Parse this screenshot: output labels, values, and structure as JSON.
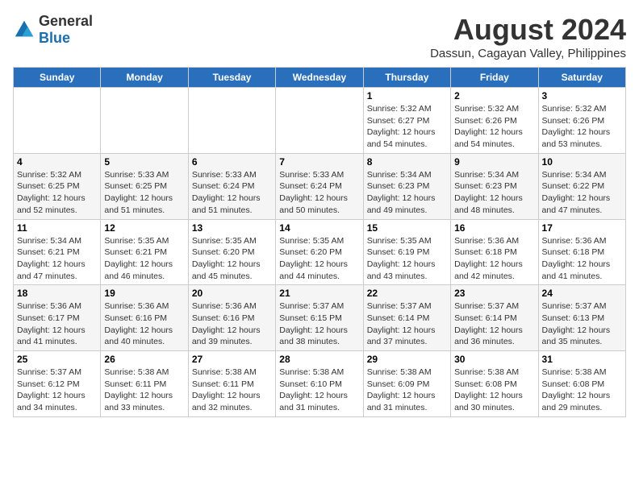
{
  "logo": {
    "general": "General",
    "blue": "Blue"
  },
  "title": "August 2024",
  "subtitle": "Dassun, Cagayan Valley, Philippines",
  "weekdays": [
    "Sunday",
    "Monday",
    "Tuesday",
    "Wednesday",
    "Thursday",
    "Friday",
    "Saturday"
  ],
  "weeks": [
    [
      {
        "day": "",
        "info": ""
      },
      {
        "day": "",
        "info": ""
      },
      {
        "day": "",
        "info": ""
      },
      {
        "day": "",
        "info": ""
      },
      {
        "day": "1",
        "info": "Sunrise: 5:32 AM\nSunset: 6:27 PM\nDaylight: 12 hours\nand 54 minutes."
      },
      {
        "day": "2",
        "info": "Sunrise: 5:32 AM\nSunset: 6:26 PM\nDaylight: 12 hours\nand 54 minutes."
      },
      {
        "day": "3",
        "info": "Sunrise: 5:32 AM\nSunset: 6:26 PM\nDaylight: 12 hours\nand 53 minutes."
      }
    ],
    [
      {
        "day": "4",
        "info": "Sunrise: 5:32 AM\nSunset: 6:25 PM\nDaylight: 12 hours\nand 52 minutes."
      },
      {
        "day": "5",
        "info": "Sunrise: 5:33 AM\nSunset: 6:25 PM\nDaylight: 12 hours\nand 51 minutes."
      },
      {
        "day": "6",
        "info": "Sunrise: 5:33 AM\nSunset: 6:24 PM\nDaylight: 12 hours\nand 51 minutes."
      },
      {
        "day": "7",
        "info": "Sunrise: 5:33 AM\nSunset: 6:24 PM\nDaylight: 12 hours\nand 50 minutes."
      },
      {
        "day": "8",
        "info": "Sunrise: 5:34 AM\nSunset: 6:23 PM\nDaylight: 12 hours\nand 49 minutes."
      },
      {
        "day": "9",
        "info": "Sunrise: 5:34 AM\nSunset: 6:23 PM\nDaylight: 12 hours\nand 48 minutes."
      },
      {
        "day": "10",
        "info": "Sunrise: 5:34 AM\nSunset: 6:22 PM\nDaylight: 12 hours\nand 47 minutes."
      }
    ],
    [
      {
        "day": "11",
        "info": "Sunrise: 5:34 AM\nSunset: 6:21 PM\nDaylight: 12 hours\nand 47 minutes."
      },
      {
        "day": "12",
        "info": "Sunrise: 5:35 AM\nSunset: 6:21 PM\nDaylight: 12 hours\nand 46 minutes."
      },
      {
        "day": "13",
        "info": "Sunrise: 5:35 AM\nSunset: 6:20 PM\nDaylight: 12 hours\nand 45 minutes."
      },
      {
        "day": "14",
        "info": "Sunrise: 5:35 AM\nSunset: 6:20 PM\nDaylight: 12 hours\nand 44 minutes."
      },
      {
        "day": "15",
        "info": "Sunrise: 5:35 AM\nSunset: 6:19 PM\nDaylight: 12 hours\nand 43 minutes."
      },
      {
        "day": "16",
        "info": "Sunrise: 5:36 AM\nSunset: 6:18 PM\nDaylight: 12 hours\nand 42 minutes."
      },
      {
        "day": "17",
        "info": "Sunrise: 5:36 AM\nSunset: 6:18 PM\nDaylight: 12 hours\nand 41 minutes."
      }
    ],
    [
      {
        "day": "18",
        "info": "Sunrise: 5:36 AM\nSunset: 6:17 PM\nDaylight: 12 hours\nand 41 minutes."
      },
      {
        "day": "19",
        "info": "Sunrise: 5:36 AM\nSunset: 6:16 PM\nDaylight: 12 hours\nand 40 minutes."
      },
      {
        "day": "20",
        "info": "Sunrise: 5:36 AM\nSunset: 6:16 PM\nDaylight: 12 hours\nand 39 minutes."
      },
      {
        "day": "21",
        "info": "Sunrise: 5:37 AM\nSunset: 6:15 PM\nDaylight: 12 hours\nand 38 minutes."
      },
      {
        "day": "22",
        "info": "Sunrise: 5:37 AM\nSunset: 6:14 PM\nDaylight: 12 hours\nand 37 minutes."
      },
      {
        "day": "23",
        "info": "Sunrise: 5:37 AM\nSunset: 6:14 PM\nDaylight: 12 hours\nand 36 minutes."
      },
      {
        "day": "24",
        "info": "Sunrise: 5:37 AM\nSunset: 6:13 PM\nDaylight: 12 hours\nand 35 minutes."
      }
    ],
    [
      {
        "day": "25",
        "info": "Sunrise: 5:37 AM\nSunset: 6:12 PM\nDaylight: 12 hours\nand 34 minutes."
      },
      {
        "day": "26",
        "info": "Sunrise: 5:38 AM\nSunset: 6:11 PM\nDaylight: 12 hours\nand 33 minutes."
      },
      {
        "day": "27",
        "info": "Sunrise: 5:38 AM\nSunset: 6:11 PM\nDaylight: 12 hours\nand 32 minutes."
      },
      {
        "day": "28",
        "info": "Sunrise: 5:38 AM\nSunset: 6:10 PM\nDaylight: 12 hours\nand 31 minutes."
      },
      {
        "day": "29",
        "info": "Sunrise: 5:38 AM\nSunset: 6:09 PM\nDaylight: 12 hours\nand 31 minutes."
      },
      {
        "day": "30",
        "info": "Sunrise: 5:38 AM\nSunset: 6:08 PM\nDaylight: 12 hours\nand 30 minutes."
      },
      {
        "day": "31",
        "info": "Sunrise: 5:38 AM\nSunset: 6:08 PM\nDaylight: 12 hours\nand 29 minutes."
      }
    ]
  ]
}
